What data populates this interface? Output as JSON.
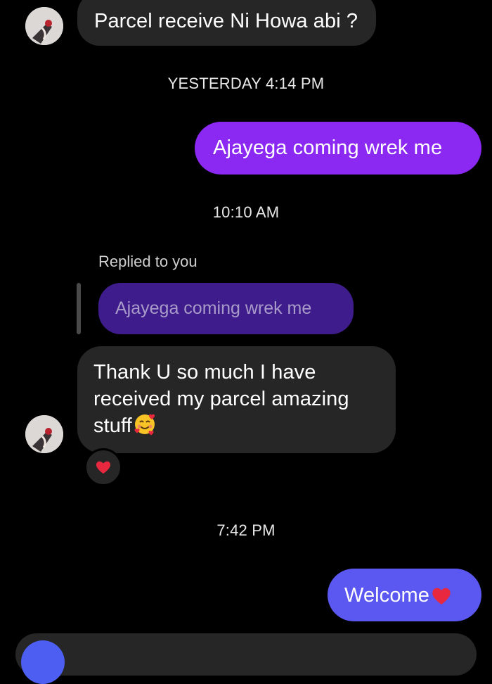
{
  "colors": {
    "background": "#000000",
    "incoming_bubble": "#262626",
    "outgoing_bubble": "#8b28f2",
    "outgoing_bubble_last": "#5b58f2",
    "reply_quote": "#3e1c8c",
    "heart": "#e8283e"
  },
  "messages": {
    "msg1": {
      "text": "Parcel receive Ni Howa abi ?"
    },
    "timestamp1": "YESTERDAY 4:14 PM",
    "msg2": {
      "text": "Ajayega coming wrek me"
    },
    "timestamp2": "10:10 AM",
    "reply": {
      "label": "Replied to you",
      "quoted_text": "Ajayega coming wrek me"
    },
    "msg3": {
      "line1": "Thank U so much I have",
      "line2": "received my parcel amazing",
      "line3": "stuff",
      "emoji": "smiling-face-with-hearts-icon",
      "reaction": "red-heart-icon"
    },
    "timestamp3": "7:42 PM",
    "msg4": {
      "text": "Welcome",
      "emoji": "red-heart-icon"
    }
  }
}
